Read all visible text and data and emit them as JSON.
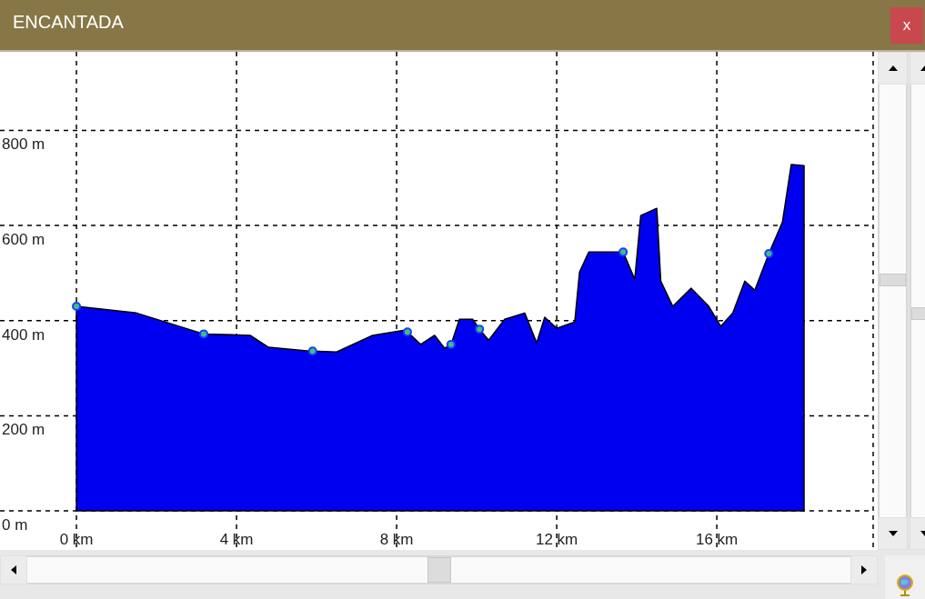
{
  "window": {
    "title": "ENCANTADA",
    "close_label": "x"
  },
  "profile": {
    "chart_data": {
      "type": "area",
      "grid": true,
      "xlim": [
        -1.91,
        20.02
      ],
      "ylim": [
        -185.2,
        1074
      ],
      "xticks": [
        {
          "value": 0,
          "label": "0 km"
        },
        {
          "value": 4,
          "label": "4 km"
        },
        {
          "value": 8,
          "label": "8 km"
        },
        {
          "value": 12,
          "label": "12 km"
        },
        {
          "value": 16,
          "label": "16 km"
        }
      ],
      "yticks": [
        {
          "value": 0,
          "label": "0 m"
        },
        {
          "value": 200,
          "label": "200 m"
        },
        {
          "value": 400,
          "label": "400 m"
        },
        {
          "value": 600,
          "label": "600 m"
        },
        {
          "value": 800,
          "label": "800 m"
        }
      ],
      "x": [
        0,
        1.5,
        3.18,
        4.34,
        4.8,
        5.82,
        5.9,
        6.5,
        7.4,
        8.2,
        8.27,
        8.6,
        8.95,
        9.2,
        9.36,
        9.57,
        9.9,
        10.07,
        10.3,
        10.7,
        11.2,
        11.5,
        11.7,
        12.0,
        12.45,
        12.57,
        12.8,
        13.66,
        13.95,
        14.1,
        14.5,
        14.6,
        14.9,
        15.36,
        15.8,
        16.1,
        16.4,
        16.7,
        16.95,
        17.3,
        17.64,
        17.86,
        18.18
      ],
      "series": [
        {
          "color": "#0000f0",
          "values": [
            430,
            416,
            372,
            369,
            344,
            336,
            336,
            334,
            369,
            380,
            376,
            350,
            369,
            342,
            350,
            403,
            403,
            382,
            359,
            403,
            416,
            353,
            407,
            384,
            397,
            502,
            544,
            544,
            487,
            621,
            636,
            483,
            430,
            468,
            430,
            388,
            416,
            483,
            464,
            541,
            607,
            728,
            726
          ]
        }
      ]
    }
  }
}
